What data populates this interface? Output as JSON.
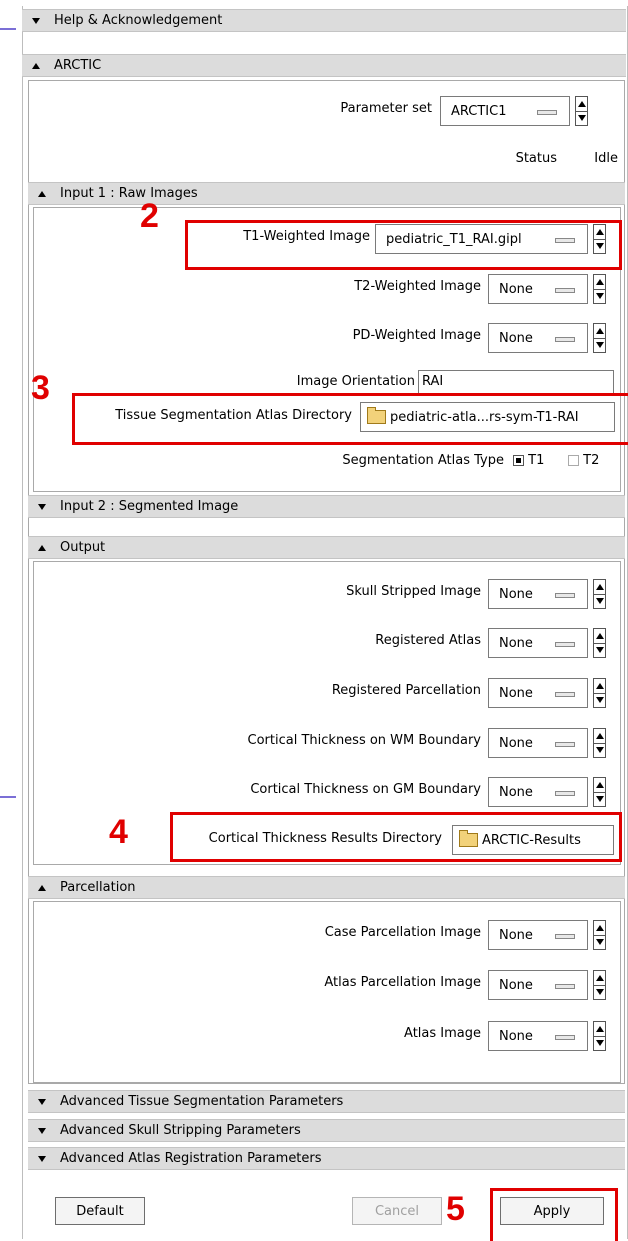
{
  "sections": {
    "help": "Help & Acknowledgement",
    "arctic": "ARCTIC",
    "input1": "Input 1 : Raw Images",
    "input2": "Input 2 : Segmented Image",
    "output": "Output",
    "parcellation": "Parcellation",
    "adv_tissue": "Advanced Tissue Segmentation Parameters",
    "adv_skull": "Advanced Skull Stripping Parameters",
    "adv_atlas": "Advanced Atlas Registration Parameters"
  },
  "arctic": {
    "param_set_label": "Parameter set",
    "param_set_value": "ARCTIC1",
    "status_label": "Status",
    "status_value": "Idle"
  },
  "input1": {
    "t1_label": "T1-Weighted Image",
    "t1_value": "pediatric_T1_RAI.gipl",
    "t2_label": "T2-Weighted Image",
    "t2_value": "None",
    "pd_label": "PD-Weighted Image",
    "pd_value": "None",
    "orient_label": "Image Orientation",
    "orient_value": "RAI",
    "atlas_dir_label": "Tissue Segmentation Atlas Directory",
    "atlas_dir_value": "pediatric-atla...rs-sym-T1-RAI",
    "atlas_type_label": "Segmentation Atlas Type",
    "atlas_type_t1": "T1",
    "atlas_type_t2": "T2"
  },
  "output": {
    "skull_label": "Skull Stripped Image",
    "skull_value": "None",
    "reg_atlas_label": "Registered Atlas",
    "reg_atlas_value": "None",
    "reg_parc_label": "Registered Parcellation",
    "reg_parc_value": "None",
    "ct_wm_label": "Cortical Thickness on WM Boundary",
    "ct_wm_value": "None",
    "ct_gm_label": "Cortical Thickness on GM Boundary",
    "ct_gm_value": "None",
    "results_dir_label": "Cortical Thickness Results Directory",
    "results_dir_value": "ARCTIC-Results"
  },
  "parcellation": {
    "case_label": "Case Parcellation Image",
    "case_value": "None",
    "atlas_parc_label": "Atlas Parcellation Image",
    "atlas_parc_value": "None",
    "atlas_img_label": "Atlas Image",
    "atlas_img_value": "None"
  },
  "buttons": {
    "default": "Default",
    "cancel": "Cancel",
    "apply": "Apply"
  },
  "annotations": {
    "n2": "2",
    "n3": "3",
    "n4": "4",
    "n5": "5"
  },
  "colors": {
    "highlight": "#e00000",
    "header_bg": "#dcdcdc",
    "marker": "#7b6fd6"
  }
}
